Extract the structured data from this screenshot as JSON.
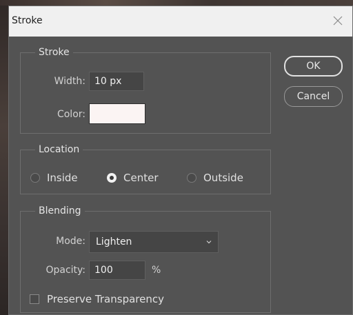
{
  "dialog": {
    "title": "Stroke",
    "close_icon": "close-x-icon"
  },
  "stroke": {
    "legend": "Stroke",
    "width_label": "Width:",
    "width_value": "10 px",
    "color_label": "Color:",
    "color_value": "#fbf4f3"
  },
  "location": {
    "legend": "Location",
    "options": [
      {
        "label": "Inside",
        "selected": false
      },
      {
        "label": "Center",
        "selected": true
      },
      {
        "label": "Outside",
        "selected": false
      }
    ]
  },
  "blending": {
    "legend": "Blending",
    "mode_label": "Mode:",
    "mode_value": "Lighten",
    "opacity_label": "Opacity:",
    "opacity_value": "100",
    "opacity_unit": "%",
    "preserve_label": "Preserve Transparency",
    "preserve_checked": false
  },
  "buttons": {
    "ok": "OK",
    "cancel": "Cancel"
  }
}
